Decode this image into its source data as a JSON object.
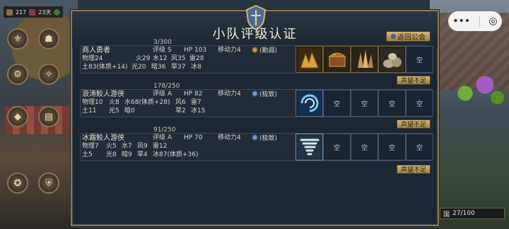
{
  "status": {
    "level": "217",
    "days": "23天"
  },
  "wechat": {
    "more": "•••",
    "close": "◎"
  },
  "dialog": {
    "title": "小队评级认证",
    "return_label": "返回公会"
  },
  "slot_empty": "空",
  "squads": [
    {
      "progress": "3/300",
      "name": "商人勇者",
      "rating": "评级 S",
      "hp": "HP 103",
      "move": "移动力4",
      "rank": "(勤弱)",
      "line2": [
        "物理24",
        "火29",
        "水12",
        "风35",
        "雷28"
      ],
      "line3": [
        "土83(体质+14)",
        "光20",
        "暗36",
        "草37",
        "冰8"
      ],
      "slots": [
        "gold-ore",
        "treasure-chest",
        "crystal-shards",
        "rock-pile",
        "空"
      ],
      "reputation_label": "声望不足"
    },
    {
      "progress": "178/250",
      "name": "浪涛鲛人游侠",
      "rating": "评级 A",
      "hp": "HP 82",
      "move": "移动力4",
      "rank": "(极致)",
      "line2": [
        "物理10",
        "火8",
        "水68(体质+28)",
        "风6",
        "雷7"
      ],
      "line3": [
        "土11",
        "光5",
        "暗0",
        "草2",
        "冰15"
      ],
      "slots": [
        "water-vortex",
        "空",
        "空",
        "空",
        "空"
      ],
      "reputation_label": "声望不足"
    },
    {
      "progress": "91/250",
      "name": "冰霜鲛人游侠",
      "rating": "评级 A",
      "hp": "HP 70",
      "move": "移动力4",
      "rank": "(极致)",
      "line2": [
        "物理7",
        "火5",
        "水7",
        "风9",
        "雷12"
      ],
      "line3": [
        "土5",
        "光8",
        "暗9",
        "草4",
        "冰87(体质+36)"
      ],
      "slots": [
        "frost-tornado",
        "空",
        "空",
        "空",
        "空"
      ],
      "reputation_label": "声望不足"
    }
  ],
  "counter": "27/100",
  "colors": {
    "frame_gold": "#8d7a52",
    "panel_bg": "#1d2733",
    "button_gold": "#cfb777"
  }
}
